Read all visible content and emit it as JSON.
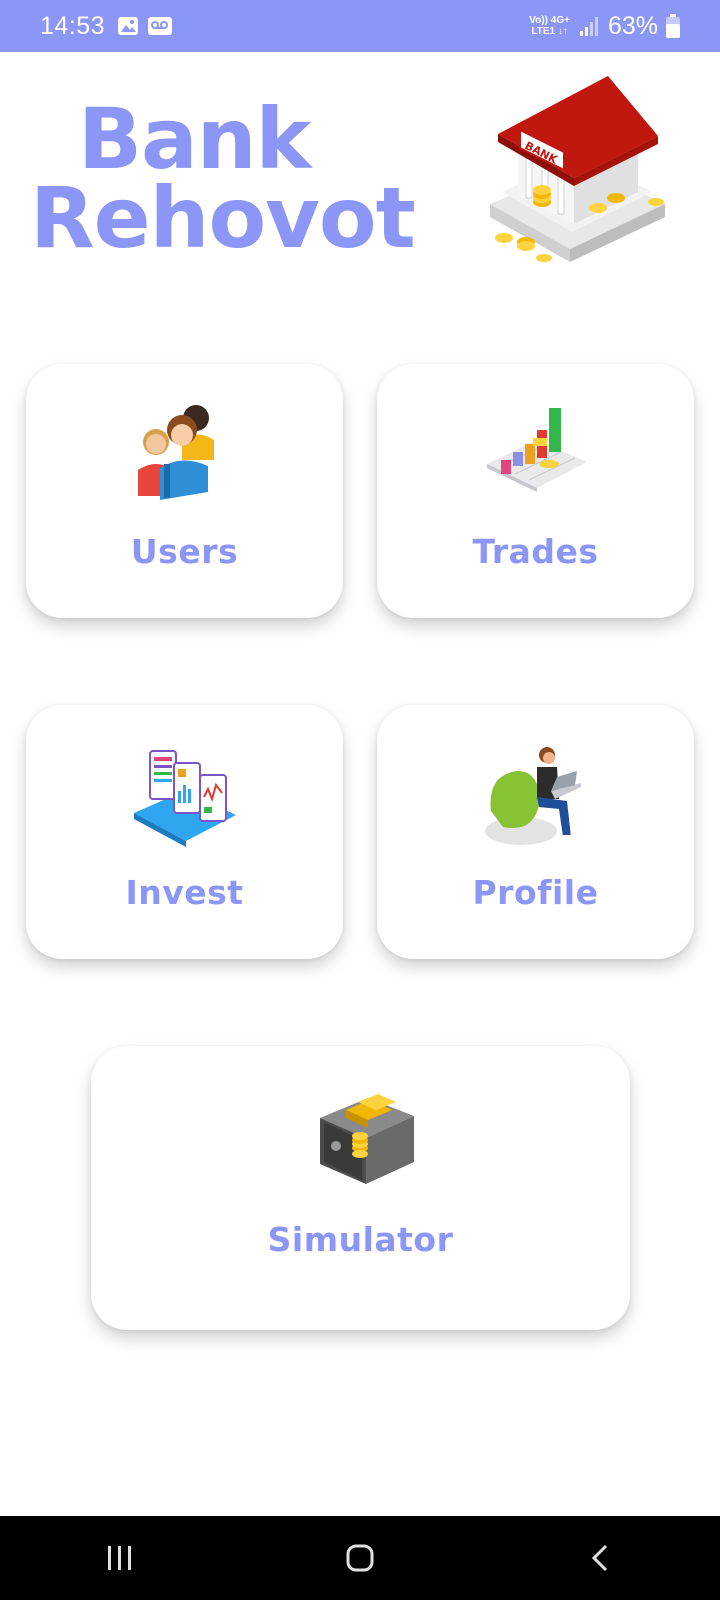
{
  "status_bar": {
    "time": "14:53",
    "network_top": "Vo)) 4G+",
    "network_bottom": "LTE1 ↓↑",
    "battery": "63%"
  },
  "header": {
    "title_line1": "Bank",
    "title_line2": "Rehovot",
    "bank_sign": "BANK"
  },
  "cards": {
    "users": "Users",
    "trades": "Trades",
    "invest": "Invest",
    "profile": "Profile",
    "simulator": "Simulator"
  },
  "colors": {
    "accent": "#8b96f6",
    "status_bar": "#8b96f6",
    "nav_bar": "#000000"
  },
  "icons": {
    "users": "users-group-icon",
    "trades": "bar-chart-icon",
    "invest": "investment-screens-icon",
    "profile": "person-laptop-icon",
    "simulator": "safe-gold-icon",
    "bank": "bank-building-icon"
  }
}
